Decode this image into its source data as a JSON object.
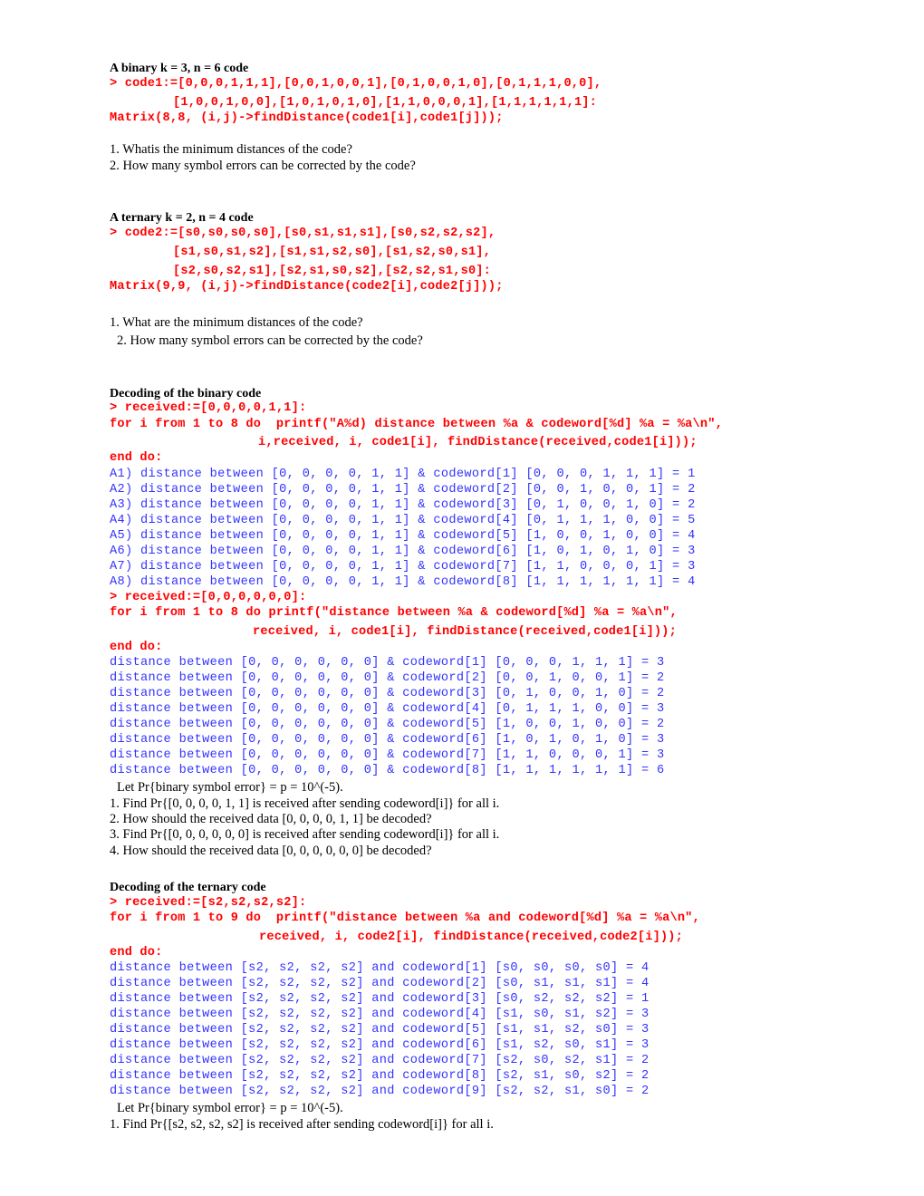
{
  "section1": {
    "heading": "A binary k = 3, n = 6 code",
    "code_lines": [
      "> code1:=[0,0,0,1,1,1],[0,0,1,0,0,1],[0,1,0,0,1,0],[0,1,1,1,0,0],",
      "[1,0,0,1,0,0],[1,0,1,0,1,0],[1,1,0,0,0,1],[1,1,1,1,1,1]:",
      "Matrix(8,8, (i,j)->findDistance(code1[i],code1[j]));"
    ],
    "questions": [
      "1. Whatis the minimum distances of the code?",
      "2. How many symbol errors can be corrected by the code?"
    ]
  },
  "section2": {
    "heading": "A ternary k = 2, n = 4 code",
    "code_lines": [
      "> code2:=[s0,s0,s0,s0],[s0,s1,s1,s1],[s0,s2,s2,s2],",
      "[s1,s0,s1,s2],[s1,s1,s2,s0],[s1,s2,s0,s1],",
      "[s2,s0,s2,s1],[s2,s1,s0,s2],[s2,s2,s1,s0]:",
      "Matrix(9,9, (i,j)->findDistance(code2[i],code2[j]));"
    ],
    "questions": [
      "1. What are the minimum distances of the code?",
      "2. How many symbol errors can be corrected by the code?"
    ]
  },
  "section3": {
    "heading": "Decoding of the binary code",
    "block1": {
      "code_lines": [
        "> received:=[0,0,0,0,1,1]:",
        "for i from 1 to 8 do  printf(\"A%d) distance between %a & codeword[%d] %a = %a\\n\",",
        "i,received, i, code1[i], findDistance(received,code1[i]));",
        "end do:"
      ],
      "output": [
        "A1) distance between [0, 0, 0, 0, 1, 1] & codeword[1] [0, 0, 0, 1, 1, 1] = 1",
        "A2) distance between [0, 0, 0, 0, 1, 1] & codeword[2] [0, 0, 1, 0, 0, 1] = 2",
        "A3) distance between [0, 0, 0, 0, 1, 1] & codeword[3] [0, 1, 0, 0, 1, 0] = 2",
        "A4) distance between [0, 0, 0, 0, 1, 1] & codeword[4] [0, 1, 1, 1, 0, 0] = 5",
        "A5) distance between [0, 0, 0, 0, 1, 1] & codeword[5] [1, 0, 0, 1, 0, 0] = 4",
        "A6) distance between [0, 0, 0, 0, 1, 1] & codeword[6] [1, 0, 1, 0, 1, 0] = 3",
        "A7) distance between [0, 0, 0, 0, 1, 1] & codeword[7] [1, 1, 0, 0, 0, 1] = 3",
        "A8) distance between [0, 0, 0, 0, 1, 1] & codeword[8] [1, 1, 1, 1, 1, 1] = 4"
      ]
    },
    "block2": {
      "code_lines": [
        "> received:=[0,0,0,0,0,0]:",
        "for i from 1 to 8 do printf(\"distance between %a & codeword[%d] %a = %a\\n\",",
        "received, i, code1[i], findDistance(received,code1[i]));",
        "end do:"
      ],
      "output": [
        "distance between [0, 0, 0, 0, 0, 0] & codeword[1] [0, 0, 0, 1, 1, 1] = 3",
        "distance between [0, 0, 0, 0, 0, 0] & codeword[2] [0, 0, 1, 0, 0, 1] = 2",
        "distance between [0, 0, 0, 0, 0, 0] & codeword[3] [0, 1, 0, 0, 1, 0] = 2",
        "distance between [0, 0, 0, 0, 0, 0] & codeword[4] [0, 1, 1, 1, 0, 0] = 3",
        "distance between [0, 0, 0, 0, 0, 0] & codeword[5] [1, 0, 0, 1, 0, 0] = 2",
        "distance between [0, 0, 0, 0, 0, 0] & codeword[6] [1, 0, 1, 0, 1, 0] = 3",
        "distance between [0, 0, 0, 0, 0, 0] & codeword[7] [1, 1, 0, 0, 0, 1] = 3",
        "distance between [0, 0, 0, 0, 0, 0] & codeword[8] [1, 1, 1, 1, 1, 1] = 6"
      ]
    },
    "questions": [
      "Let Pr{binary symbol error} = p = 10^(-5).",
      "1. Find Pr{[0, 0, 0, 0, 1, 1] is received after sending codeword[i]} for all i.",
      "2. How should the received data [0, 0, 0, 0, 1, 1] be decoded?",
      "3. Find Pr{[0, 0, 0, 0, 0, 0] is received after sending codeword[i]} for all i.",
      "4. How should the received data [0, 0, 0, 0, 0, 0] be decoded?"
    ]
  },
  "section4": {
    "heading": "Decoding of the ternary code",
    "code_lines": [
      "> received:=[s2,s2,s2,s2]:",
      "for i from 1 to 9 do  printf(\"distance between %a and codeword[%d] %a = %a\\n\",",
      "received, i, code2[i], findDistance(received,code2[i]));",
      "end do:"
    ],
    "output": [
      "distance between [s2, s2, s2, s2] and codeword[1] [s0, s0, s0, s0] = 4",
      "distance between [s2, s2, s2, s2] and codeword[2] [s0, s1, s1, s1] = 4",
      "distance between [s2, s2, s2, s2] and codeword[3] [s0, s2, s2, s2] = 1",
      "distance between [s2, s2, s2, s2] and codeword[4] [s1, s0, s1, s2] = 3",
      "distance between [s2, s2, s2, s2] and codeword[5] [s1, s1, s2, s0] = 3",
      "distance between [s2, s2, s2, s2] and codeword[6] [s1, s2, s0, s1] = 3",
      "distance between [s2, s2, s2, s2] and codeword[7] [s2, s0, s2, s1] = 2",
      "distance between [s2, s2, s2, s2] and codeword[8] [s2, s1, s0, s2] = 2",
      "distance between [s2, s2, s2, s2] and codeword[9] [s2, s2, s1, s0] = 2"
    ],
    "questions": [
      "Let Pr{binary symbol error} = p = 10^(-5).",
      "1. Find Pr{[s2, s2, s2, s2] is received after sending codeword[i]} for all i."
    ]
  },
  "colors": {
    "input_code": "#ff0000",
    "output_text": "#3333ff",
    "body_text": "#000000"
  }
}
